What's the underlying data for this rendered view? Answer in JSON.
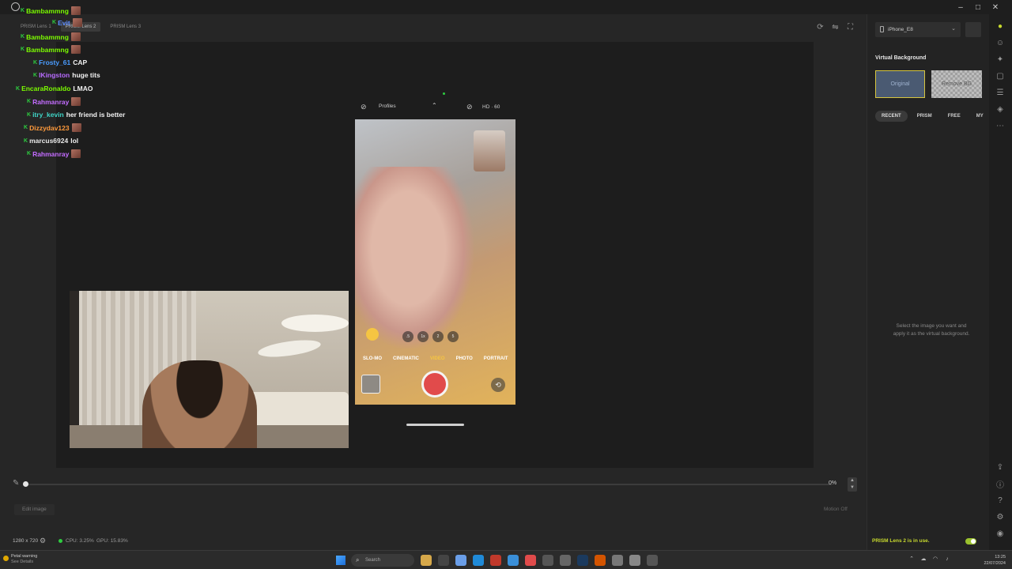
{
  "window": {
    "controls": [
      "–",
      "□",
      "✕"
    ]
  },
  "lens_tabs": [
    {
      "label": "PRISM Lens 1",
      "active": false
    },
    {
      "label": "PRISM Lens 2",
      "active": true
    },
    {
      "label": "PRISM Lens 3",
      "active": false
    }
  ],
  "chat": [
    {
      "user": "Bambammng",
      "color": "#7CFC00",
      "msg": ""
    },
    {
      "user": "Evit",
      "color": "#5b8cff",
      "msg": ""
    },
    {
      "user": "Bambammng",
      "color": "#7CFC00",
      "msg": ""
    },
    {
      "user": "Bambammng",
      "color": "#7CFC00",
      "msg": ""
    },
    {
      "user": "Frosty_61",
      "color": "#4a9cff",
      "msg": "CAP"
    },
    {
      "user": "lKingston",
      "color": "#b86bff",
      "msg": "huge tits"
    },
    {
      "user": "EncaraRonaldo",
      "color": "#7CFC00",
      "msg": "LMAO"
    },
    {
      "user": "Rahmanray",
      "color": "#c36cff",
      "msg": ""
    },
    {
      "user": "itry_kevin",
      "color": "#3fd6c8",
      "msg": "her friend is better"
    },
    {
      "user": "Dizzydav123",
      "color": "#ff9a3c",
      "msg": ""
    },
    {
      "user": "marcus6924",
      "color": "#e8e8e8",
      "msg": "lol"
    },
    {
      "user": "Rahmanray",
      "color": "#c36cff",
      "msg": ""
    }
  ],
  "phone_ui": {
    "top_left": "Profiles",
    "top_right": "HD · 60",
    "zoom": [
      ".5",
      "1x",
      "2",
      "5"
    ],
    "modes": [
      "SLO-MO",
      "CINEMATIC",
      "VIDEO",
      "PHOTO",
      "PORTRAIT"
    ],
    "active_mode": "VIDEO"
  },
  "timeline": {
    "percent": "0%",
    "progress": 0
  },
  "edit_image_label": "Edit image",
  "motion_label": "Motion Off",
  "status": {
    "resolution": "1280 x 720",
    "cpu": "CPU: 3.25%",
    "gpu": "GPU: 15.83%"
  },
  "right_panel": {
    "device": "iPhone_E8",
    "title": "Virtual Background",
    "original_label": "Original",
    "remove_bg_label": "Remove BG",
    "tabs": [
      {
        "label": "RECENT",
        "active": true
      },
      {
        "label": "PRISM",
        "active": false
      },
      {
        "label": "FREE",
        "active": false
      },
      {
        "label": "MY",
        "active": false
      }
    ],
    "hint": "Select the image you want and apply it as the virtual background.",
    "lens_status": "PRISM Lens 2 is in use."
  },
  "taskbar": {
    "weather_title": "Petal warning",
    "weather_sub": "See Details",
    "search_placeholder": "Search",
    "clock_time": "13:25",
    "clock_date": "22/07/2024"
  },
  "colors": {
    "accent": "#c7d92e",
    "selected_border": "#d7c640"
  }
}
